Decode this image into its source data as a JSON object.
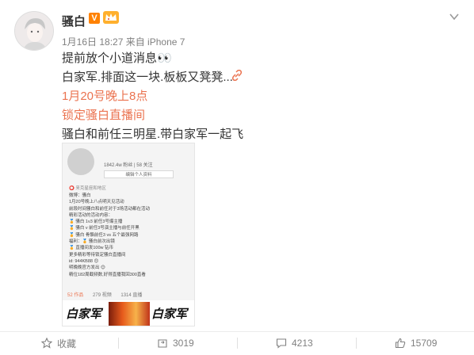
{
  "post": {
    "username": "骚白",
    "vip_badge": "V",
    "meta": "1月16日 18:27 来自 iPhone 7",
    "lines": [
      "提前放个小道消息👀",
      "白家军.排面这一块.板板又凳凳...",
      "1月20号晚上8点",
      "锁定骚白直播间",
      "骚白和前任三明星.带白家军一起飞"
    ],
    "accent_color": "#eb7350"
  },
  "embed": {
    "stats": "1842.4w 粉丝  |  58 关注",
    "edit_button": "编辑个人资料",
    "location": "⭕ 来克星座和地区",
    "lines": [
      "微博：骚白",
      "1月20号晚上八点明天见活动",
      "前段时间骚白和前任对于3场活动都在活动",
      "精彩活动的活动内容：",
      "  🏅 骚白 1v3 前任3号爆主播",
      "  🏅 骚白 v 前任3号演主播与前任开黑",
      "  🏅 骚白 骨骼前任3 vs 五个最强网路",
      "福利：🏅 骚白前次出镜",
      "        🏅 直播间发100w 钻币",
      "更多精彩等待锁定骚白直播间",
      "id: 944KB88 😊",
      "明晚晚官方发出 😊",
      "精位182周截频数,好得直播我回300直看"
    ],
    "footer": [
      "52 作品",
      "279 视频",
      "1314 直播"
    ],
    "banner_left": "白家军",
    "banner_right": "白家军"
  },
  "actions": {
    "favorite": "收藏",
    "repost": "3019",
    "comment": "4213",
    "like": "15709"
  }
}
